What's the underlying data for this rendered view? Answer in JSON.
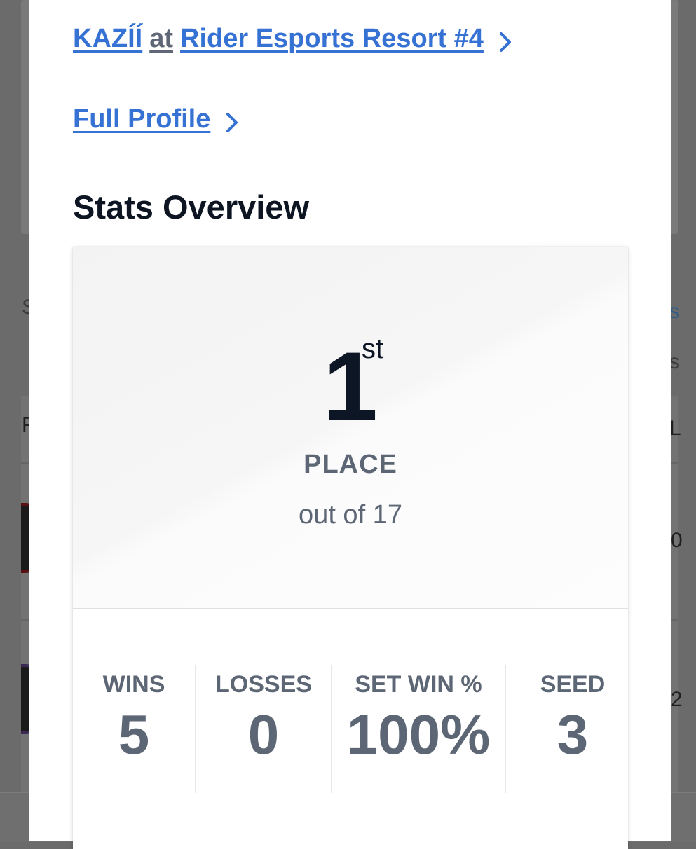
{
  "background": {
    "left_fragment_1": "S",
    "left_fragment_2": "P",
    "right_fragment_1": "s",
    "right_fragment_2": "s",
    "right_fragment_3": "L",
    "right_fragment_4": "0",
    "right_fragment_5": "2"
  },
  "breadcrumb": {
    "player": "KAZÍÍ",
    "connector": "at",
    "tournament": "Rider Esports Resort #4"
  },
  "profile_link": "Full Profile",
  "section_title": "Stats Overview",
  "placement": {
    "number": "1",
    "suffix": "st",
    "label": "PLACE",
    "out_of": "out of 17"
  },
  "stats": [
    {
      "label": "WINS",
      "value": "5"
    },
    {
      "label": "LOSSES",
      "value": "0"
    },
    {
      "label": "SET WIN %",
      "value": "100%"
    },
    {
      "label": "SEED",
      "value": "3"
    }
  ],
  "colors": {
    "link": "#3672d4",
    "heading": "#0d1422",
    "muted": "#5d6674"
  },
  "icons": {
    "chevron": "chevron-right-icon"
  }
}
